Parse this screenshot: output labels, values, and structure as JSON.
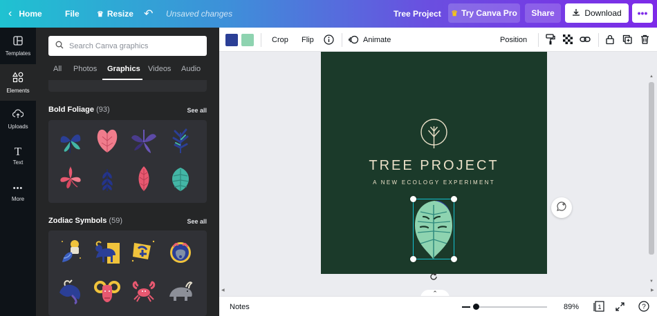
{
  "topbar": {
    "home_label": "Home",
    "file_label": "File",
    "resize_label": "Resize",
    "unsaved_label": "Unsaved changes",
    "project_title": "Tree Project",
    "try_pro_label": "Try Canva Pro",
    "share_label": "Share",
    "download_label": "Download"
  },
  "rail": {
    "items": [
      {
        "label": "Templates",
        "icon": "templates-icon"
      },
      {
        "label": "Elements",
        "icon": "elements-icon"
      },
      {
        "label": "Uploads",
        "icon": "uploads-icon"
      },
      {
        "label": "Text",
        "icon": "text-icon"
      },
      {
        "label": "More",
        "icon": "more-icon"
      }
    ]
  },
  "panel": {
    "search_placeholder": "Search Canva graphics",
    "tabs": [
      "All",
      "Photos",
      "Graphics",
      "Videos",
      "Audio"
    ],
    "active_tab": "Graphics",
    "sections": [
      {
        "title": "Bold Foliage",
        "count": "(93)",
        "see_all": "See all"
      },
      {
        "title": "Zodiac Symbols",
        "count": "(59)",
        "see_all": "See all"
      }
    ]
  },
  "toolbar": {
    "colors": [
      "#2b3f96",
      "#8ed3b0"
    ],
    "crop_label": "Crop",
    "flip_label": "Flip",
    "animate_label": "Animate",
    "position_label": "Position"
  },
  "canvas": {
    "title": "TREE PROJECT",
    "subtitle": "A NEW ECOLOGY EXPERIMENT",
    "background": "#1b3a2a"
  },
  "bottombar": {
    "notes_label": "Notes",
    "zoom": "89%",
    "page_number": "1",
    "help": "?"
  }
}
